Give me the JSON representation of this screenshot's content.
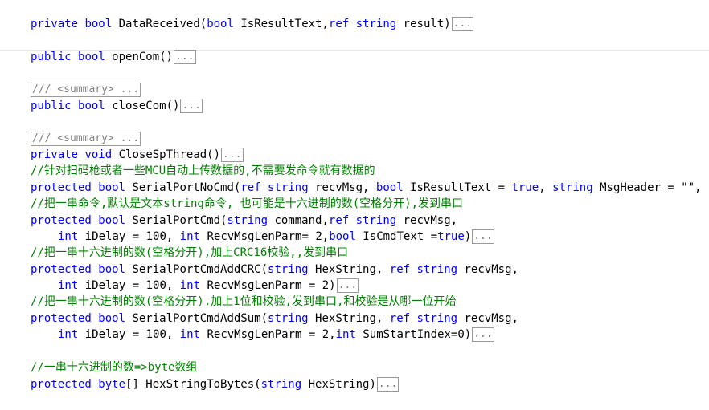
{
  "code": {
    "placeholder_summary": "/// <summary> ...",
    "collapsed_marker": "...",
    "lines": {
      "l1_kw1": "private",
      "l1_kw2": "bool",
      "l1_a": " DataReceived(",
      "l1_kw3": "bool",
      "l1_b": " IsResultText,",
      "l1_kw4": "ref",
      "l1_kw5": "string",
      "l1_c": " result)",
      "l2_kw1": "public",
      "l2_kw2": "bool",
      "l2_a": " openCom()",
      "l4_kw1": "public",
      "l4_kw2": "bool",
      "l4_a": " closeCom()",
      "l6_kw1": "private",
      "l6_kw2": "void",
      "l6_a": " CloseSpThread()",
      "l7_comment": "//针对扫码枪或者一些MCU自动上传数据的,不需要发命令就有数据的",
      "l8_kw1": "protected",
      "l8_kw2": "bool",
      "l8_a": " SerialPortNoCmd(",
      "l8_kw3": "ref",
      "l8_kw4": "string",
      "l8_b": " recvMsg, ",
      "l8_kw5": "bool",
      "l8_c": " IsResultText = ",
      "l8_kw6": "true",
      "l8_d": ", ",
      "l8_kw7": "string",
      "l8_e": " MsgHeader = \"\",",
      "l9_comment": "//把一串命令,默认是文本string命令, 也可能是十六进制的数(空格分开),发到串口",
      "l10_kw1": "protected",
      "l10_kw2": "bool",
      "l10_a": " SerialPortCmd(",
      "l10_kw3": "string",
      "l10_b": " command,",
      "l10_kw4": "ref",
      "l10_kw5": "string",
      "l10_c": " recvMsg,",
      "l11_kw1": "int",
      "l11_a": " iDelay = 100, ",
      "l11_kw2": "int",
      "l11_b": " RecvMsgLenParm= 2,",
      "l11_kw3": "bool",
      "l11_c": " IsCmdText =",
      "l11_kw4": "true",
      "l11_d": ")",
      "l12_comment": "//把一串十六进制的数(空格分开),加上CRC16校验,,发到串口",
      "l13_kw1": "protected",
      "l13_kw2": "bool",
      "l13_a": " SerialPortCmdAddCRC(",
      "l13_kw3": "string",
      "l13_b": " HexString, ",
      "l13_kw4": "ref",
      "l13_kw5": "string",
      "l13_c": " recvMsg,",
      "l14_kw1": "int",
      "l14_a": " iDelay = 100, ",
      "l14_kw2": "int",
      "l14_b": " RecvMsgLenParm = 2)",
      "l15_comment": "//把一串十六进制的数(空格分开),加上1位和校验,发到串口,和校验是从哪一位开始",
      "l16_kw1": "protected",
      "l16_kw2": "bool",
      "l16_a": " SerialPortCmdAddSum(",
      "l16_kw3": "string",
      "l16_b": " HexString, ",
      "l16_kw4": "ref",
      "l16_kw5": "string",
      "l16_c": " recvMsg,",
      "l17_kw1": "int",
      "l17_a": " iDelay = 100, ",
      "l17_kw2": "int",
      "l17_b": " RecvMsgLenParm = 2,",
      "l17_kw3": "int",
      "l17_c": " SumStartIndex=0)",
      "l18_comment": "//一串十六进制的数=>byte数组",
      "l19_kw1": "protected",
      "l19_kw2": "byte",
      "l19_a": "[] HexStringToBytes(",
      "l19_kw3": "string",
      "l19_b": " HexString)"
    }
  },
  "colors": {
    "keyword": "#0000ff",
    "comment": "#008000",
    "text": "#000000",
    "collapsed": "#808080"
  }
}
